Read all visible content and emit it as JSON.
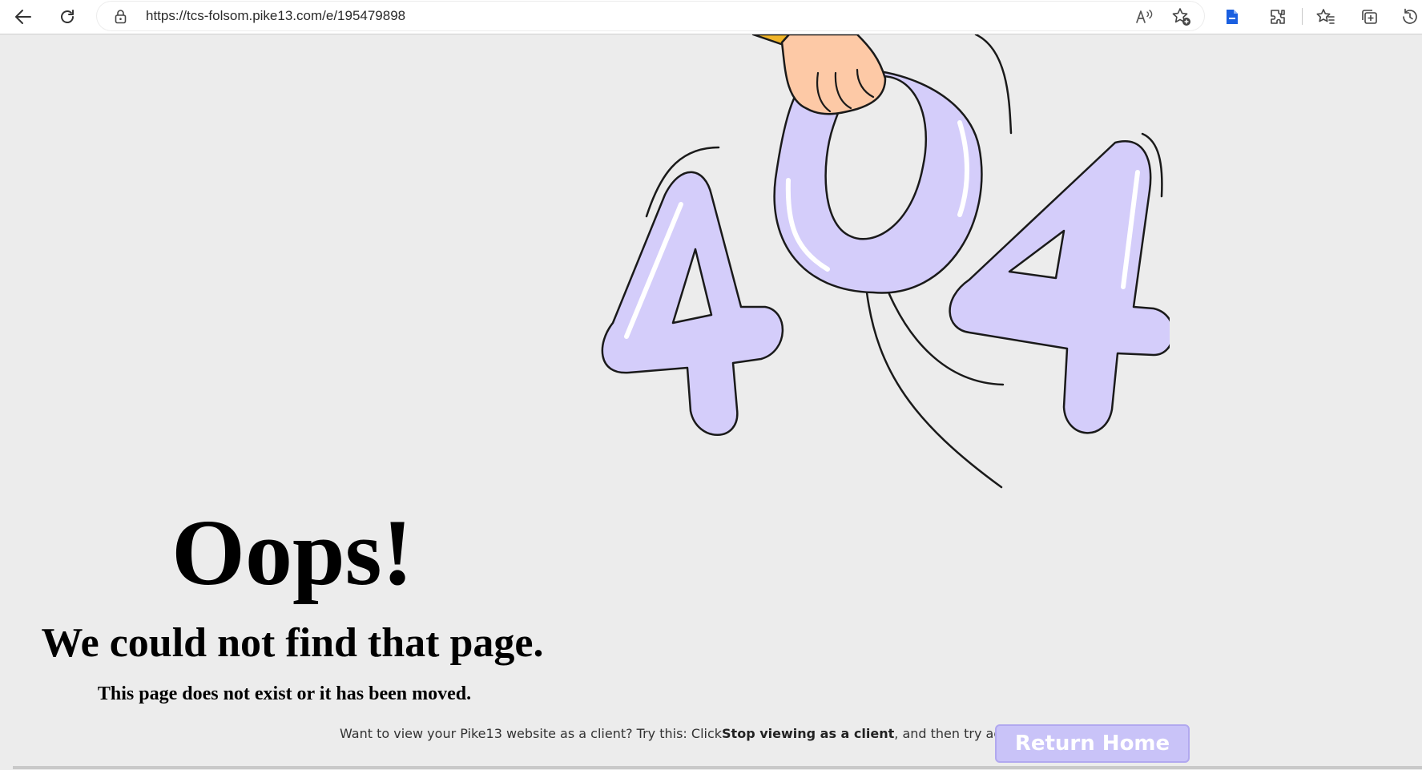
{
  "browser": {
    "url": "https://tcs-folsom.pike13.com/e/195479898",
    "icons": [
      "back-arrow-icon",
      "refresh-icon",
      "lock-icon",
      "read-aloud-icon",
      "add-favorite-icon",
      "document-extension-icon",
      "extensions-icon",
      "favorites-icon",
      "collections-icon",
      "history-icon"
    ]
  },
  "illustration": {
    "code": "404",
    "fill_color": "#d4cdfa",
    "stroke_color": "#1a1a1a",
    "hand_color": "#fdc9a6",
    "sleeve_color": "#f0b429"
  },
  "content": {
    "heading": "Oops!",
    "subheading": "We could not find that page.",
    "description": "This page does not exist or it has been moved.",
    "hint_prefix": "Want to view your Pike13 website as a client? Try this: Click",
    "hint_bold": "Stop viewing as a client",
    "hint_suffix": ", and then try again.",
    "return_button": "Return Home"
  },
  "colors": {
    "page_background": "#ececec",
    "button_background": "#c9c3f8",
    "button_border": "#b1a8ef",
    "button_text": "#ffffff"
  }
}
